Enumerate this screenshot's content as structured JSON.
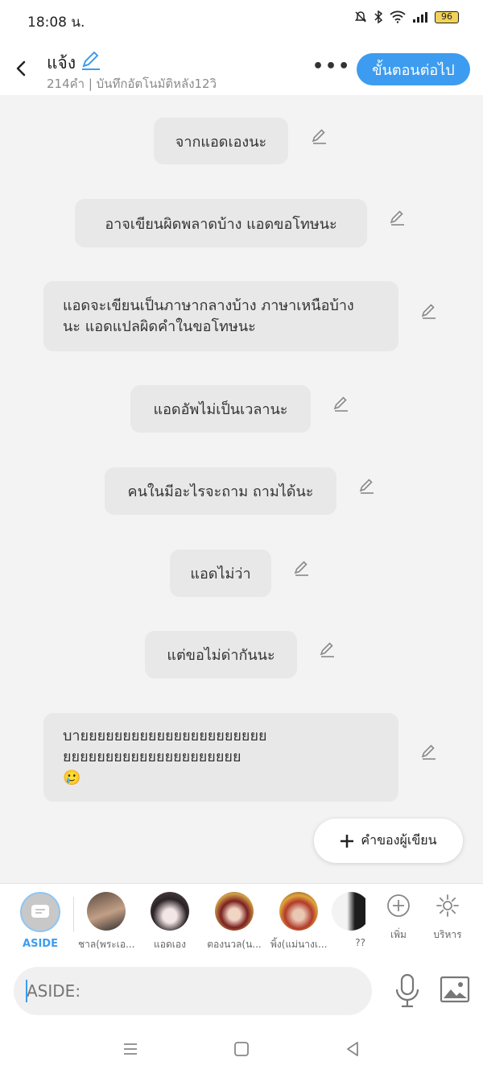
{
  "status": {
    "time": "18:08 น.",
    "battery": "96"
  },
  "header": {
    "title": "แจ้ง",
    "subtitle": "214คำ | บันทึกอัตโนมัติหลัง12วิ",
    "more": "•••",
    "next_label": "ขั้นตอนต่อไป"
  },
  "messages": [
    {
      "text": "จากแอดเองนะ"
    },
    {
      "text": "อาจเขียนผิดพลาดบ้าง แอดขอโทษนะ"
    },
    {
      "line1": "แอดจะเขียนเป็นภาษากลางบ้าง ภาษาเหนือบ้าง",
      "line2": "นะ แอดแปลผิดคำในขอโทษนะ"
    },
    {
      "text": "แอดอัพไม่เป็นเวลานะ"
    },
    {
      "text": "คนในมีอะไรจะถาม ถามได้นะ"
    },
    {
      "text": "แอดไม่ว่า"
    },
    {
      "text": "แต่ขอไม่ด่ากันนะ"
    },
    {
      "line1": "บายยยยยยยยยยยยยยยยยยยยยย",
      "line2": "ยยยยยยยยยยยยยยยยยยยยย",
      "emoji": "🥲"
    }
  ],
  "author_button": {
    "icon": "plus-icon",
    "label": "คำของผู้เขียน"
  },
  "characters": [
    {
      "name": "ASIDE"
    },
    {
      "name": "ชาล(พระเอ..."
    },
    {
      "name": "แอดเอง"
    },
    {
      "name": "ตองนวล(น..."
    },
    {
      "name": "พิ้ง(แม่นางเ..."
    },
    {
      "name": "??"
    }
  ],
  "tools": {
    "add_label": "เพิ่ม",
    "manage_label": "บริหาร"
  },
  "input": {
    "placeholder": "ASIDE:"
  },
  "colors": {
    "accent": "#3d9cf0",
    "bubble": "#e8e8e8",
    "background": "#f3f3f3"
  }
}
